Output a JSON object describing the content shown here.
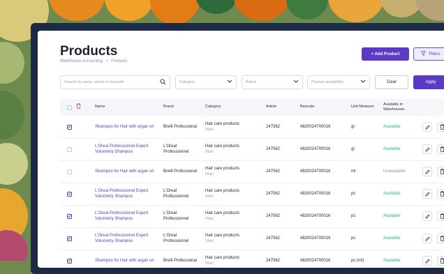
{
  "page": {
    "title": "Products",
    "breadcrumb": [
      "Warehouse Accounting",
      ">",
      "Products"
    ],
    "add_button": "+ Add Product",
    "filters_button": "Filters"
  },
  "filters": {
    "search_placeholder": "Search by name, article or barcode",
    "category": "Category",
    "brand": "Brand",
    "availability": "Product availability",
    "clear": "Clear",
    "apply": "Apply"
  },
  "table": {
    "headers": {
      "name": "Name",
      "brand": "Brand",
      "category": "Category",
      "article": "Article",
      "barcode": "Barcode",
      "unit": "Unit Measure",
      "available": "Available in Warehouses"
    },
    "rows": [
      {
        "checked": true,
        "name": "Shampoo for Hair with argan oil",
        "brand": "Brelil Professional",
        "category": "Hair care products",
        "subcategory": "(Hair)",
        "article": "247562",
        "barcode": "4820024700016",
        "unit": "gr",
        "status": "Available"
      },
      {
        "checked": false,
        "name": "L'Oreal Professionnel Expert Volumetry Shampoo",
        "brand": "L'Oreal Professionnel",
        "category": "Hair care products",
        "subcategory": "(Hair)",
        "article": "247562",
        "barcode": "4820024700016",
        "unit": "gr",
        "status": "Available"
      },
      {
        "checked": false,
        "name": "Shampoo for Hair with argan oil",
        "brand": "Brelil Professional",
        "category": "Hair care products",
        "subcategory": "(Hair)",
        "article": "247562",
        "barcode": "4820024700016",
        "unit": "ml",
        "status": "Unavailable"
      },
      {
        "checked": true,
        "name": "L'Oreal Professionnel Expert Volumetry Shampoo",
        "brand": "L'Oreal Professionnel",
        "category": "Hair care products",
        "subcategory": "(Hair)",
        "article": "247562",
        "barcode": "4820024700016",
        "unit": "pc",
        "status": "Available"
      },
      {
        "checked": true,
        "name": "L'Oreal Professionnel Expert Volumetry Shampoo",
        "brand": "L'Oreal Professionnel",
        "category": "Hair care products",
        "subcategory": "(Hair)",
        "article": "247562",
        "barcode": "4820024700016",
        "unit": "pc",
        "status": "Available"
      },
      {
        "checked": true,
        "name": "L'Oreal Professionnel Expert Volumetry Shampoo",
        "brand": "L'Oreal Professionnel",
        "category": "Hair care products",
        "subcategory": "(Hair)",
        "article": "247562",
        "barcode": "4820024700016",
        "unit": "pc",
        "status": "Available"
      },
      {
        "checked": true,
        "name": "Shampoo for Hair with argan oil",
        "brand": "Brelil Professional",
        "category": "Hair care products",
        "subcategory": "(Hair)",
        "article": "247562",
        "barcode": "4820024700016",
        "unit": "pc (ml)",
        "status": "Available"
      }
    ]
  },
  "colors": {
    "accent": "#5b3bc4",
    "available": "#2bb673",
    "unavailable": "#8b90a0",
    "frame": "#1d2a45"
  }
}
